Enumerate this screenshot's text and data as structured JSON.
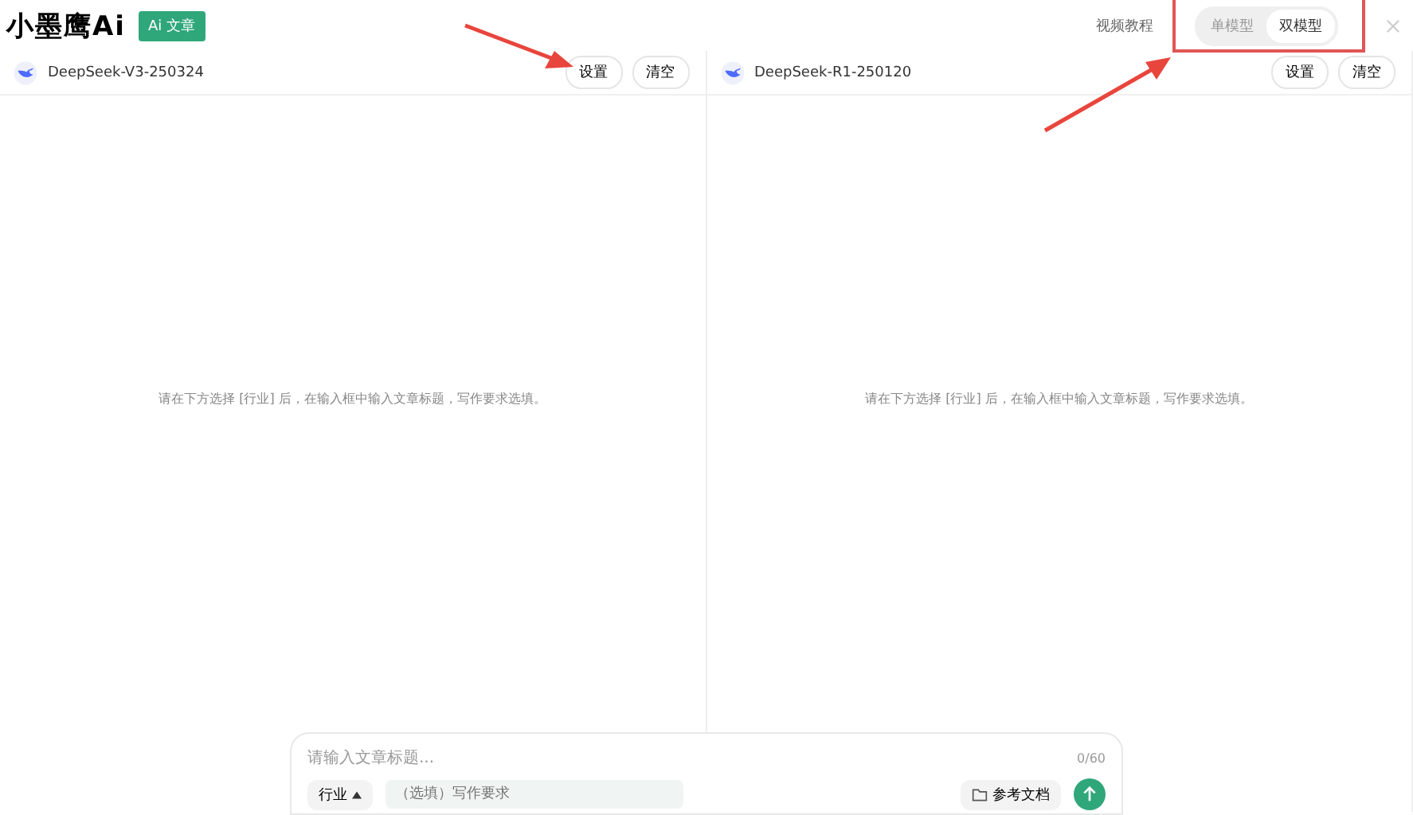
{
  "header": {
    "logo": "小墨鹰Ai",
    "badge": "Ai 文章",
    "tutorial_link": "视频教程",
    "mode_options": [
      {
        "label": "单模型",
        "selected": false
      },
      {
        "label": "双模型",
        "selected": true
      }
    ]
  },
  "panels": [
    {
      "model": "DeepSeek-V3-250324",
      "buttons": [
        "设置",
        "清空"
      ],
      "hint": "请在下方选择 [行业] 后，在输入框中输入文章标题，写作要求选填。"
    },
    {
      "model": "DeepSeek-R1-250120",
      "buttons": [
        "设置",
        "清空"
      ],
      "hint": "请在下方选择 [行业] 后，在输入框中输入文章标题，写作要求选填。"
    }
  ],
  "composer": {
    "placeholder": "请输入文章标题...",
    "counter": "0/60",
    "industry": "行业",
    "requirements_placeholder": "（选填）写作要求",
    "reference_button": "参考文档"
  }
}
